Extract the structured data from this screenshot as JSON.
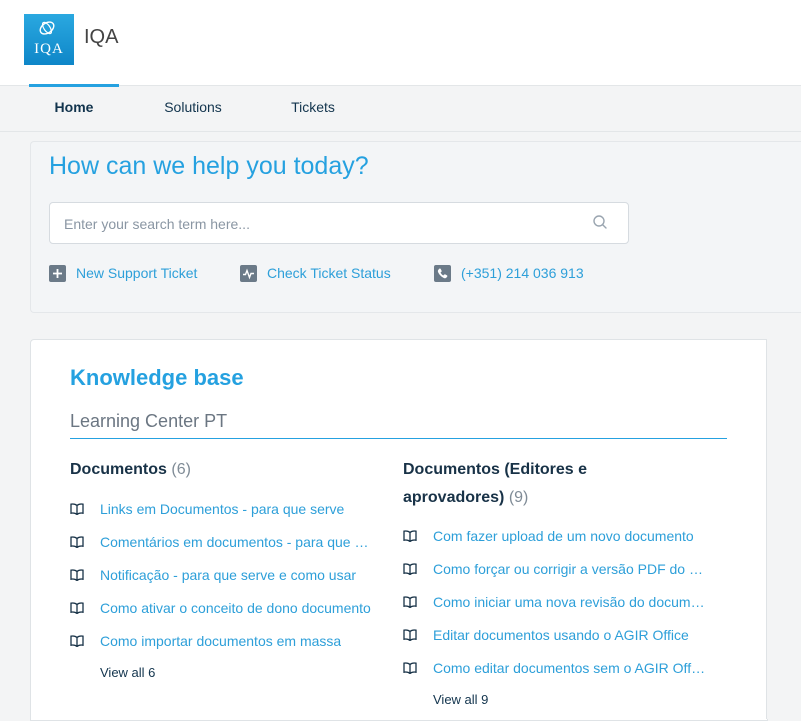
{
  "brand": {
    "logo_text": "IQA",
    "name": "IQA"
  },
  "nav": {
    "tabs": [
      {
        "label": "Home"
      },
      {
        "label": "Solutions"
      },
      {
        "label": "Tickets"
      }
    ]
  },
  "hero": {
    "title": "How can we help you today?",
    "search_placeholder": "Enter your search term here...",
    "actions": [
      {
        "label": "New Support Ticket",
        "icon": "plus-icon"
      },
      {
        "label": "Check Ticket Status",
        "icon": "activity-icon"
      },
      {
        "label": "(+351) 214 036 913",
        "icon": "phone-icon"
      }
    ]
  },
  "kb": {
    "title": "Knowledge base",
    "category": "Learning Center PT",
    "folders": [
      {
        "title": "Documentos",
        "count": "(6)",
        "articles": [
          "Links em Documentos - para que serve",
          "Comentários em documentos - para que servem",
          "Notificação - para que serve e como usar",
          "Como ativar o conceito de dono documento",
          "Como importar documentos em massa"
        ],
        "view_all": "View all 6"
      },
      {
        "title": "Documentos (Editores e aprovadores)",
        "count": "(9)",
        "articles": [
          "Com fazer upload de um novo documento",
          "Como forçar ou corrigir a versão PDF do documento",
          "Como iniciar uma nova revisão do documento",
          "Editar documentos usando o AGIR Office",
          "Como editar documentos sem o AGIR Office"
        ],
        "view_all": "View all 9"
      }
    ]
  },
  "colors": {
    "accent": "#25a1e0",
    "link": "#2d9fd9",
    "text": "#183247",
    "icon": "#6b7a88"
  }
}
